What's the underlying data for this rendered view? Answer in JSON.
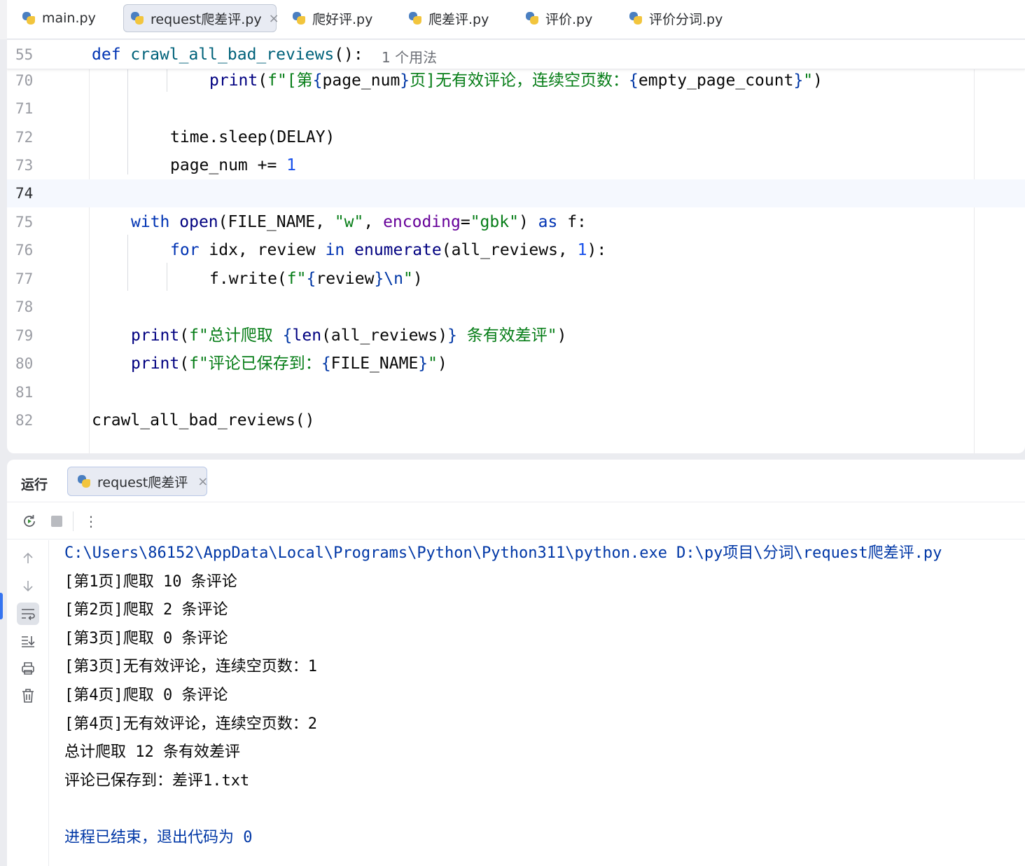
{
  "tabs": [
    {
      "label": "main.py",
      "active": false
    },
    {
      "label": "request爬差评.py",
      "active": true
    },
    {
      "label": "爬好评.py",
      "active": false
    },
    {
      "label": "爬差评.py",
      "active": false
    },
    {
      "label": "评价.py",
      "active": false
    },
    {
      "label": "评价分词.py",
      "active": false
    }
  ],
  "editor": {
    "current_line": "74",
    "sticky": {
      "line_number": "55",
      "tokens": [
        "def",
        " ",
        "crawl_all_bad_reviews",
        "():"
      ],
      "hint": "1 个用法"
    },
    "lines": {
      "l70": {
        "n": "70",
        "t": [
          "print",
          "(",
          "f\"[第",
          "{",
          "page_num",
          "}",
          "页]无有效评论，连续空页数：",
          "{",
          "empty_page_count",
          "}",
          "\"",
          ")"
        ]
      },
      "l71": {
        "n": "71"
      },
      "l72": {
        "n": "72",
        "t": [
          "time.sleep(DELAY)"
        ]
      },
      "l73": {
        "n": "73",
        "t": [
          "page_num += ",
          "1"
        ]
      },
      "l74": {
        "n": "74"
      },
      "l75": {
        "n": "75",
        "t": [
          "with",
          " ",
          "open",
          "(FILE_NAME, ",
          "\"w\"",
          ", ",
          "encoding",
          "=",
          "\"gbk\"",
          ") ",
          "as",
          " f:"
        ]
      },
      "l76": {
        "n": "76",
        "t": [
          "for",
          " idx, review ",
          "in",
          " ",
          "enumerate",
          "(all_reviews, ",
          "1",
          "):"
        ]
      },
      "l77": {
        "n": "77",
        "t": [
          "f.write(",
          "f\"",
          "{",
          "review",
          "}",
          "\\n",
          "\"",
          ")"
        ]
      },
      "l78": {
        "n": "78"
      },
      "l79": {
        "n": "79",
        "t": [
          "print",
          "(",
          "f\"总计爬取 ",
          "{",
          "len",
          "(all_reviews)",
          "}",
          " 条有效差评\"",
          ")"
        ]
      },
      "l80": {
        "n": "80",
        "t": [
          "print",
          "(",
          "f\"评论已保存到：",
          "{",
          "FILE_NAME",
          "}",
          "\"",
          ")"
        ]
      },
      "l81": {
        "n": "81"
      },
      "l82": {
        "n": "82",
        "t": [
          "crawl_all_bad_reviews()"
        ]
      }
    }
  },
  "run_panel": {
    "title": "运行",
    "tab_label": "request爬差评",
    "console": [
      "C:\\Users\\86152\\AppData\\Local\\Programs\\Python\\Python311\\python.exe D:\\py项目\\分词\\request爬差评.py",
      "[第1页]爬取 10 条评论",
      "[第2页]爬取 2 条评论",
      "[第3页]爬取 0 条评论",
      "[第3页]无有效评论，连续空页数：1",
      "[第4页]爬取 0 条评论",
      "[第4页]无有效评论，连续空页数：2",
      "总计爬取 12 条有效差评",
      "评论已保存到：差评1.txt",
      "",
      "进程已结束，退出代码为 0"
    ]
  },
  "icons": {
    "tab_file": "python-file-icon",
    "tab_close": "close-icon",
    "rerun": "rerun-icon",
    "stop": "stop-icon",
    "more": "more-vertical-icon",
    "up": "arrow-up-icon",
    "down": "arrow-down-icon",
    "wrap": "soft-wrap-icon",
    "scroll_end": "scroll-to-end-icon",
    "print": "print-icon",
    "clear": "trash-icon"
  }
}
